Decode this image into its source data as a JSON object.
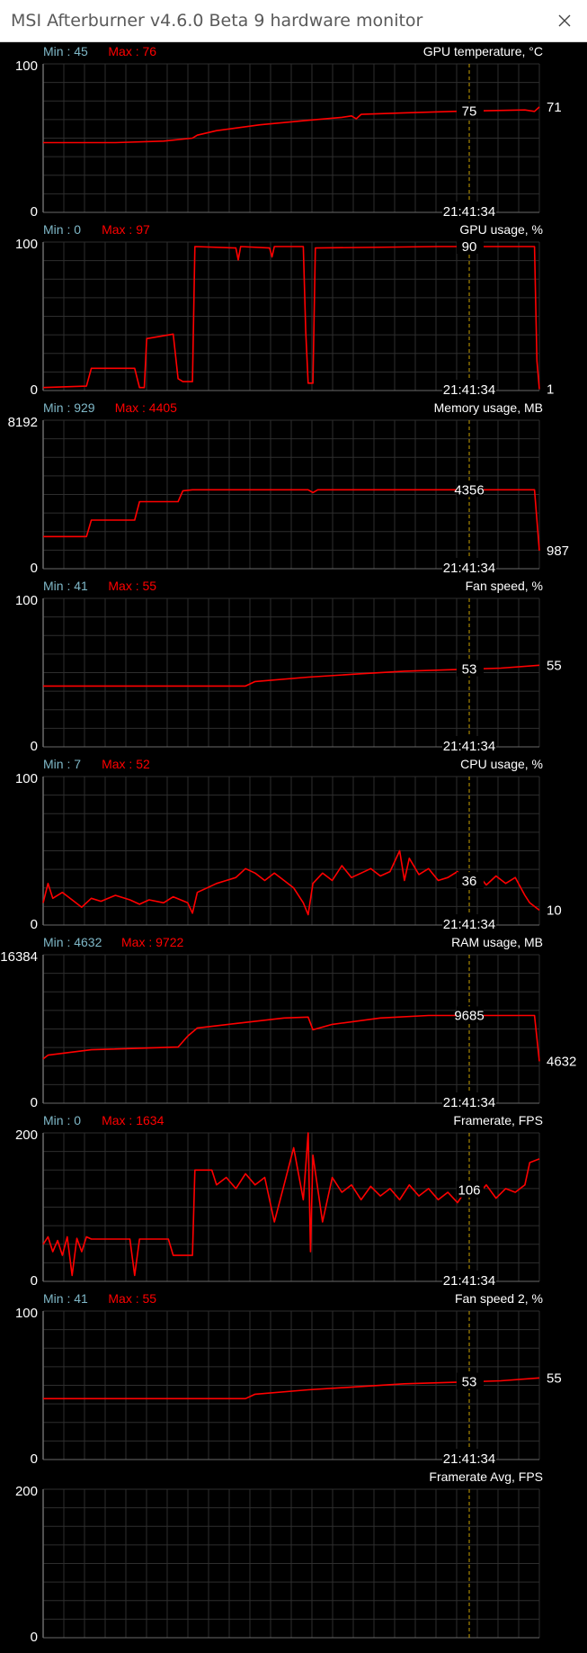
{
  "window": {
    "title": "MSI Afterburner v4.6.0 Beta 9 hardware monitor"
  },
  "colors": {
    "background": "#000000",
    "grid": "#2e2e2e",
    "border": "#6a6a6a",
    "line": "#ff0000",
    "min_label": "#7fb8c8",
    "max_label": "#ff0000",
    "text": "#ffffff",
    "cursor": "#c8a000"
  },
  "graphs": [
    {
      "name": "GPU temperature, °C",
      "min_label": "Min : 45",
      "max_label": "Max : 76",
      "y_top_label": "100",
      "y_bottom_label": "0",
      "y_max": 100,
      "cursor_time": "21:41:34",
      "cursor_value_label": "75",
      "current_value_label": "71",
      "series": [
        [
          0,
          47
        ],
        [
          15,
          47
        ],
        [
          25,
          48
        ],
        [
          31,
          50
        ],
        [
          32,
          52
        ],
        [
          36,
          55
        ],
        [
          45,
          59
        ],
        [
          55,
          62
        ],
        [
          62,
          64
        ],
        [
          64,
          65
        ],
        [
          65,
          63
        ],
        [
          66,
          66
        ],
        [
          75,
          67
        ],
        [
          85,
          68
        ],
        [
          100,
          69
        ],
        [
          102,
          68
        ],
        [
          103,
          71
        ]
      ]
    },
    {
      "name": "GPU usage, %",
      "min_label": "Min : 0",
      "max_label": "Max : 97",
      "y_top_label": "100",
      "y_bottom_label": "0",
      "y_max": 100,
      "cursor_time": "21:41:34",
      "cursor_value_label": "90",
      "current_value_label": "1",
      "series": [
        [
          0,
          2
        ],
        [
          9,
          3
        ],
        [
          10,
          15
        ],
        [
          19,
          15
        ],
        [
          20,
          2
        ],
        [
          21,
          2
        ],
        [
          21.5,
          35
        ],
        [
          27,
          38
        ],
        [
          28,
          8
        ],
        [
          29,
          6
        ],
        [
          31,
          6
        ],
        [
          31.5,
          97
        ],
        [
          40,
          96
        ],
        [
          40.5,
          88
        ],
        [
          41,
          97
        ],
        [
          47,
          96
        ],
        [
          47.5,
          90
        ],
        [
          48,
          97
        ],
        [
          54,
          97
        ],
        [
          54.5,
          40
        ],
        [
          55,
          5
        ],
        [
          56,
          5
        ],
        [
          56.5,
          96
        ],
        [
          82,
          97
        ],
        [
          95,
          97
        ],
        [
          102,
          97
        ],
        [
          102.5,
          20
        ],
        [
          103,
          1
        ]
      ]
    },
    {
      "name": "Memory usage, MB",
      "min_label": "Min : 929",
      "max_label": "Max : 4405",
      "y_top_label": "8192",
      "y_bottom_label": "0",
      "y_max": 8192,
      "cursor_time": "21:41:34",
      "cursor_value_label": "4356",
      "current_value_label": "987",
      "series": [
        [
          0,
          1770
        ],
        [
          9,
          1770
        ],
        [
          10,
          2680
        ],
        [
          19,
          2680
        ],
        [
          20,
          3700
        ],
        [
          28,
          3700
        ],
        [
          29,
          4300
        ],
        [
          31,
          4356
        ],
        [
          55,
          4356
        ],
        [
          56,
          4200
        ],
        [
          57,
          4356
        ],
        [
          102,
          4356
        ],
        [
          103,
          987
        ]
      ]
    },
    {
      "name": "Fan speed, %",
      "min_label": "Min : 41",
      "max_label": "Max : 55",
      "y_top_label": "100",
      "y_bottom_label": "0",
      "y_max": 100,
      "cursor_time": "21:41:34",
      "cursor_value_label": "53",
      "current_value_label": "55",
      "series": [
        [
          0,
          41
        ],
        [
          42,
          41
        ],
        [
          44,
          44
        ],
        [
          55,
          47
        ],
        [
          65,
          49
        ],
        [
          75,
          51
        ],
        [
          85,
          52
        ],
        [
          95,
          53
        ],
        [
          103,
          55
        ]
      ]
    },
    {
      "name": "CPU usage, %",
      "min_label": "Min : 7",
      "max_label": "Max : 52",
      "y_top_label": "100",
      "y_bottom_label": "0",
      "y_max": 100,
      "cursor_time": "21:41:34",
      "cursor_value_label": "36",
      "current_value_label": "10",
      "series": [
        [
          0,
          15
        ],
        [
          1,
          28
        ],
        [
          2,
          18
        ],
        [
          4,
          22
        ],
        [
          6,
          17
        ],
        [
          8,
          12
        ],
        [
          10,
          18
        ],
        [
          12,
          16
        ],
        [
          15,
          20
        ],
        [
          18,
          17
        ],
        [
          20,
          14
        ],
        [
          22,
          17
        ],
        [
          25,
          15
        ],
        [
          27,
          19
        ],
        [
          30,
          15
        ],
        [
          31,
          8
        ],
        [
          32,
          22
        ],
        [
          34,
          25
        ],
        [
          36,
          28
        ],
        [
          38,
          30
        ],
        [
          40,
          32
        ],
        [
          42,
          38
        ],
        [
          44,
          35
        ],
        [
          46,
          30
        ],
        [
          48,
          35
        ],
        [
          50,
          30
        ],
        [
          52,
          25
        ],
        [
          54,
          15
        ],
        [
          55,
          7
        ],
        [
          56,
          28
        ],
        [
          58,
          35
        ],
        [
          60,
          30
        ],
        [
          62,
          40
        ],
        [
          64,
          32
        ],
        [
          66,
          35
        ],
        [
          68,
          38
        ],
        [
          70,
          33
        ],
        [
          72,
          36
        ],
        [
          74,
          50
        ],
        [
          75,
          30
        ],
        [
          76,
          45
        ],
        [
          78,
          34
        ],
        [
          80,
          38
        ],
        [
          82,
          30
        ],
        [
          84,
          32
        ],
        [
          86,
          36
        ],
        [
          88,
          28
        ],
        [
          90,
          35
        ],
        [
          92,
          27
        ],
        [
          94,
          33
        ],
        [
          96,
          28
        ],
        [
          98,
          32
        ],
        [
          100,
          20
        ],
        [
          101,
          15
        ],
        [
          103,
          10
        ]
      ]
    },
    {
      "name": "RAM usage, MB",
      "min_label": "Min : 4632",
      "max_label": "Max : 9722",
      "y_top_label": "16384",
      "y_bottom_label": "0",
      "y_max": 16384,
      "cursor_time": "21:41:34",
      "cursor_value_label": "9685",
      "current_value_label": "4632",
      "series": [
        [
          0,
          4900
        ],
        [
          1,
          5300
        ],
        [
          10,
          5900
        ],
        [
          28,
          6200
        ],
        [
          30,
          7400
        ],
        [
          32,
          8300
        ],
        [
          40,
          8800
        ],
        [
          50,
          9400
        ],
        [
          55,
          9500
        ],
        [
          56,
          8100
        ],
        [
          60,
          8700
        ],
        [
          70,
          9400
        ],
        [
          80,
          9685
        ],
        [
          102,
          9685
        ],
        [
          103,
          4632
        ]
      ]
    },
    {
      "name": "Framerate, FPS",
      "min_label": "Min : 0",
      "max_label": "Max : 1634",
      "y_top_label": "200",
      "y_bottom_label": "0",
      "y_max": 200,
      "cursor_time": "21:41:34",
      "cursor_value_label": "106",
      "current_value_label": "",
      "series": [
        [
          0,
          50
        ],
        [
          1,
          60
        ],
        [
          2,
          40
        ],
        [
          3,
          55
        ],
        [
          4,
          35
        ],
        [
          5,
          60
        ],
        [
          6,
          8
        ],
        [
          7,
          58
        ],
        [
          8,
          40
        ],
        [
          9,
          60
        ],
        [
          10,
          57
        ],
        [
          18,
          57
        ],
        [
          19,
          8
        ],
        [
          20,
          57
        ],
        [
          26,
          57
        ],
        [
          27,
          35
        ],
        [
          30,
          35
        ],
        [
          31,
          35
        ],
        [
          31.5,
          150
        ],
        [
          35,
          150
        ],
        [
          36,
          130
        ],
        [
          38,
          140
        ],
        [
          40,
          125
        ],
        [
          42,
          145
        ],
        [
          44,
          130
        ],
        [
          46,
          140
        ],
        [
          48,
          80
        ],
        [
          50,
          130
        ],
        [
          52,
          180
        ],
        [
          54,
          110
        ],
        [
          55,
          200
        ],
        [
          55.5,
          40
        ],
        [
          56,
          170
        ],
        [
          58,
          80
        ],
        [
          60,
          140
        ],
        [
          62,
          120
        ],
        [
          64,
          130
        ],
        [
          66,
          110
        ],
        [
          68,
          128
        ],
        [
          70,
          115
        ],
        [
          72,
          125
        ],
        [
          74,
          110
        ],
        [
          76,
          130
        ],
        [
          78,
          115
        ],
        [
          80,
          125
        ],
        [
          82,
          110
        ],
        [
          84,
          120
        ],
        [
          86,
          106
        ],
        [
          88,
          125
        ],
        [
          90,
          115
        ],
        [
          92,
          130
        ],
        [
          94,
          112
        ],
        [
          96,
          125
        ],
        [
          98,
          120
        ],
        [
          100,
          130
        ],
        [
          101,
          160
        ],
        [
          103,
          165
        ]
      ]
    },
    {
      "name": "Fan speed 2, %",
      "min_label": "Min : 41",
      "max_label": "Max : 55",
      "y_top_label": "100",
      "y_bottom_label": "0",
      "y_max": 100,
      "cursor_time": "21:41:34",
      "cursor_value_label": "53",
      "current_value_label": "55",
      "series": [
        [
          0,
          41
        ],
        [
          42,
          41
        ],
        [
          44,
          44
        ],
        [
          55,
          47
        ],
        [
          65,
          49
        ],
        [
          75,
          51
        ],
        [
          85,
          52
        ],
        [
          95,
          53
        ],
        [
          103,
          55
        ]
      ]
    },
    {
      "name": "Framerate Avg, FPS",
      "min_label": "",
      "max_label": "",
      "y_top_label": "200",
      "y_bottom_label": "0",
      "y_max": 200,
      "cursor_time": "",
      "cursor_value_label": "",
      "current_value_label": "",
      "series": []
    }
  ]
}
